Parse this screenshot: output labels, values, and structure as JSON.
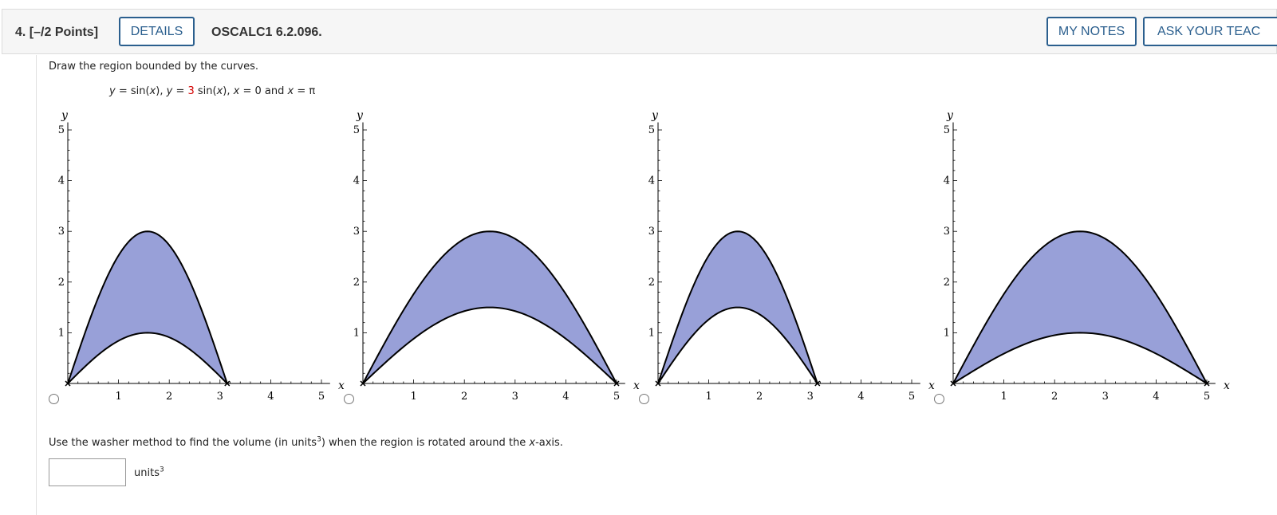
{
  "header": {
    "question_number": "4.",
    "points": "[–/2 Points]",
    "details_label": "DETAILS",
    "problem_code": "OSCALC1 6.2.096.",
    "my_notes_label": "MY NOTES",
    "ask_teacher_label": "ASK YOUR TEAC"
  },
  "prompt": "Draw the region bounded by the curves.",
  "equation": {
    "y1": "y",
    "eq1": " = sin(",
    "x1": "x",
    "close1": "), ",
    "y2": "y",
    "eq2": " = ",
    "coef": "3",
    "sin2": " sin(",
    "x2": "x",
    "close2": "), ",
    "x3": "x",
    "eq3": " = 0 and ",
    "x4": "x",
    "eq4": " = π"
  },
  "colors": {
    "fill": "#98a0d8",
    "curve": "#000000",
    "link": "#2b5f8e",
    "highlight": "#d40000"
  },
  "chart_data": [
    {
      "type": "area",
      "xlabel": "x",
      "ylabel": "y",
      "xlim": [
        0,
        5
      ],
      "ylim": [
        0,
        5
      ],
      "xticks": [
        "1",
        "2",
        "3",
        "4",
        "5"
      ],
      "yticks": [
        "1",
        "2",
        "3",
        "4",
        "5"
      ],
      "series": [
        {
          "function": "sin(x)",
          "x_end": 3.14159,
          "amplitude": 1
        },
        {
          "function": "3 sin(x)",
          "x_end": 3.14159,
          "amplitude": 3
        }
      ]
    },
    {
      "type": "area",
      "xlabel": "x",
      "ylabel": "y",
      "xlim": [
        0,
        5
      ],
      "ylim": [
        0,
        5
      ],
      "xticks": [
        "1",
        "2",
        "3",
        "4",
        "5"
      ],
      "yticks": [
        "1",
        "2",
        "3",
        "4",
        "5"
      ],
      "series": [
        {
          "x_end": 5,
          "amplitude": 1.5
        },
        {
          "x_end": 5,
          "amplitude": 3
        }
      ]
    },
    {
      "type": "area",
      "xlabel": "x",
      "ylabel": "y",
      "xlim": [
        0,
        5
      ],
      "ylim": [
        0,
        5
      ],
      "xticks": [
        "1",
        "2",
        "3",
        "4",
        "5"
      ],
      "yticks": [
        "1",
        "2",
        "3",
        "4",
        "5"
      ],
      "series": [
        {
          "x_end": 3.14159,
          "amplitude": 1.5
        },
        {
          "x_end": 3.14159,
          "amplitude": 3
        }
      ]
    },
    {
      "type": "area",
      "xlabel": "x",
      "ylabel": "y",
      "xlim": [
        0,
        5
      ],
      "ylim": [
        0,
        5
      ],
      "xticks": [
        "1",
        "2",
        "3",
        "4",
        "5"
      ],
      "yticks": [
        "1",
        "2",
        "3",
        "4",
        "5"
      ],
      "series": [
        {
          "x_end": 5,
          "amplitude": 1
        },
        {
          "x_end": 5,
          "amplitude": 3
        }
      ]
    }
  ],
  "washer": {
    "before": "Use the washer method to find the volume (in units",
    "exp": "3",
    "middle": ") when the region is rotated around the ",
    "var": "x",
    "after": "-axis."
  },
  "answer": {
    "value": "",
    "units": "units",
    "units_exp": "3"
  }
}
